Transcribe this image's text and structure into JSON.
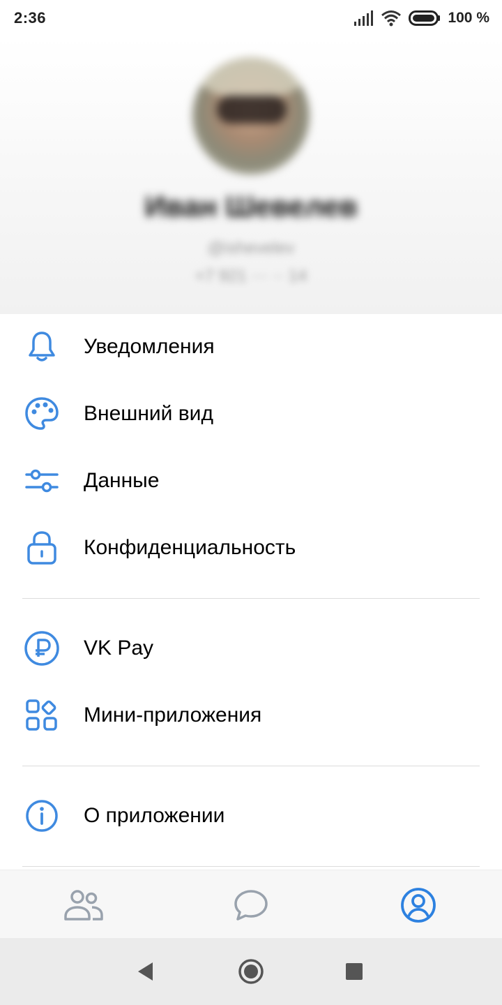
{
  "status_bar": {
    "time": "2:36",
    "battery_text": "100 %"
  },
  "profile": {
    "name": "Иван Шевелев",
    "nickname": "@ishevelev",
    "phone": "+7 921 ··· ·· 14"
  },
  "menu": {
    "notifications": "Уведомления",
    "appearance": "Внешний вид",
    "data": "Данные",
    "privacy": "Конфиденциальность",
    "vk_pay": "VK Pay",
    "mini_apps": "Мини-приложения",
    "about": "О приложении"
  },
  "tabs": {
    "active": "profile",
    "items": [
      "friends",
      "messages",
      "profile"
    ]
  },
  "icons": {
    "notifications": "bell-icon",
    "appearance": "palette-icon",
    "data": "sliders-icon",
    "privacy": "lock-icon",
    "vk_pay": "ruble-coin-icon",
    "mini_apps": "grid-icon",
    "about": "info-icon"
  },
  "colors": {
    "accent": "#3f8ae0",
    "tab_inactive": "#99a2ad",
    "tab_active": "#2d81e0"
  }
}
